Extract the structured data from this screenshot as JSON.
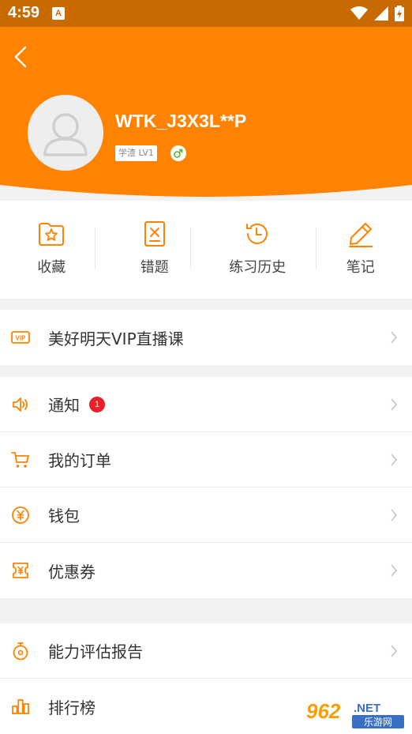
{
  "status_bar": {
    "time": "4:59",
    "app_icon": "A"
  },
  "profile": {
    "username": "WTK_J3X3L**P",
    "level": "学渣 LV1",
    "gender_icon": "male-icon"
  },
  "quick_actions": [
    {
      "label": "收藏",
      "icon": "folder-star-icon"
    },
    {
      "label": "错题",
      "icon": "wrong-question-icon"
    },
    {
      "label": "练习历史",
      "icon": "history-icon"
    },
    {
      "label": "笔记",
      "icon": "pen-icon"
    }
  ],
  "menu": {
    "vip": {
      "label": "美好明天VIP直播课",
      "icon": "vip-icon"
    },
    "notify": {
      "label": "通知",
      "badge": "1",
      "icon": "speaker-icon"
    },
    "orders": {
      "label": "我的订单",
      "icon": "cart-icon"
    },
    "wallet": {
      "label": "钱包",
      "icon": "yuan-icon"
    },
    "coupons": {
      "label": "优惠券",
      "icon": "coupon-icon"
    },
    "ability": {
      "label": "能力评估报告",
      "icon": "stopwatch-icon"
    },
    "ranking": {
      "label": "排行榜",
      "icon": "bar-chart-icon"
    }
  },
  "watermark": {
    "text_number": "962",
    "text_net": ".NET",
    "text_cn": "乐游网"
  },
  "colors": {
    "accent": "#ff8200",
    "status_bar": "#c96a00",
    "badge": "#e8202a"
  }
}
